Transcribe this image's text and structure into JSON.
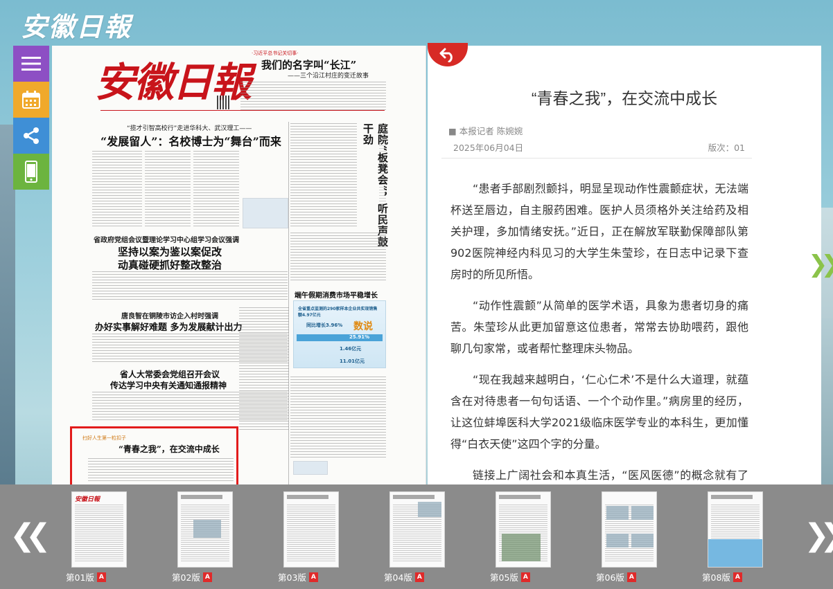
{
  "site": {
    "logo": "安徽日報"
  },
  "toolbar": {
    "items": [
      {
        "icon": "menu-icon",
        "color": "#8d4fc4"
      },
      {
        "icon": "calendar-icon",
        "color": "#f0a92b"
      },
      {
        "icon": "share-icon",
        "color": "#3f8fd6"
      },
      {
        "icon": "mobile-icon",
        "color": "#6cb43f"
      }
    ]
  },
  "newspaper": {
    "masthead": "安徽日報",
    "headlines": {
      "top_tag": "·习近平总书记关切事·",
      "top_title": "我们的名字叫“长江”",
      "top_sub": "——三个沿江村庄的变迁故事",
      "lead_tag": "“揽才引智高校行”走进华科大、武汉理工——",
      "lead_title": "“发展留人”：名校博士为“舞台”而来",
      "vertical_title": "庭院“板凳会”，听民声鼓干劲",
      "story2_tag": "省政府党组会议暨理论学习中心组学习会议强调",
      "story2_title_1": "坚持以案为鉴以案促改",
      "story2_title_2": "动真碰硬抓好整改整治",
      "story3_tag": "唐良智在铜陵市访企入村时强调",
      "story3_title": "办好实事解好难题 多为发展献计出力",
      "story4_title_1": "省人大常委会党组召开会议",
      "story4_title_2": "传达学习中央有关通知通报精神",
      "story5_title": "端午假期消费市场平稳增长",
      "highlight_tag": "扫好人生第一粒扣子",
      "highlight_title": "“青春之我”，在交流中成长",
      "info_1": "全省重点监测的290家样本企业共实现销售额4.97亿元",
      "info_2": "同比增长3.96%",
      "info_3": "数说",
      "info_4": "25.91%",
      "info_5": "1.46亿元",
      "info_6": "11.01亿元"
    }
  },
  "article": {
    "title": "“青春之我”，在交流中成长",
    "author": "■ 本报记者 陈婉婉",
    "date": "2025年06月04日",
    "page": "版次：01",
    "paragraphs": [
      "“患者手部剧烈颤抖，明显呈现动作性震颤症状，无法端杯送至唇边，自主服药困难。医护人员须格外关注给药及相关护理，多加情绪安抚。”近日，正在解放军联勤保障部队第902医院神经内科见习的大学生朱莹珍，在日志中记录下查房时的所见所悟。",
      "“动作性震颤”从简单的医学术语，具象为患者切身的痛苦。朱莹珍从此更加留意这位患者，常常去协助喂药，跟他聊几句家常，或者帮忙整理床头物品。",
      "“现在我越来越明白，‘仁心仁术’不是什么大道理，就蕴含在对待患者一句句话语、一个个动作里。”病房里的经历，让这位蚌埠医科大学2021级临床医学专业的本科生，更加懂得“白衣天使”这四个字的分量。",
      "链接上广阔社会和本真生活，“医风医德”的概念就有了内容与温度。朱莹珍是班里的思政委员。她将自己的感受发在班级思政委员“朋端”平台上。"
    ]
  },
  "thumbnails": [
    {
      "label": "第01版",
      "masthead": "安徽日報"
    },
    {
      "label": "第02版"
    },
    {
      "label": "第03版"
    },
    {
      "label": "第04版"
    },
    {
      "label": "第05版"
    },
    {
      "label": "第06版"
    },
    {
      "label": "第08版"
    }
  ]
}
